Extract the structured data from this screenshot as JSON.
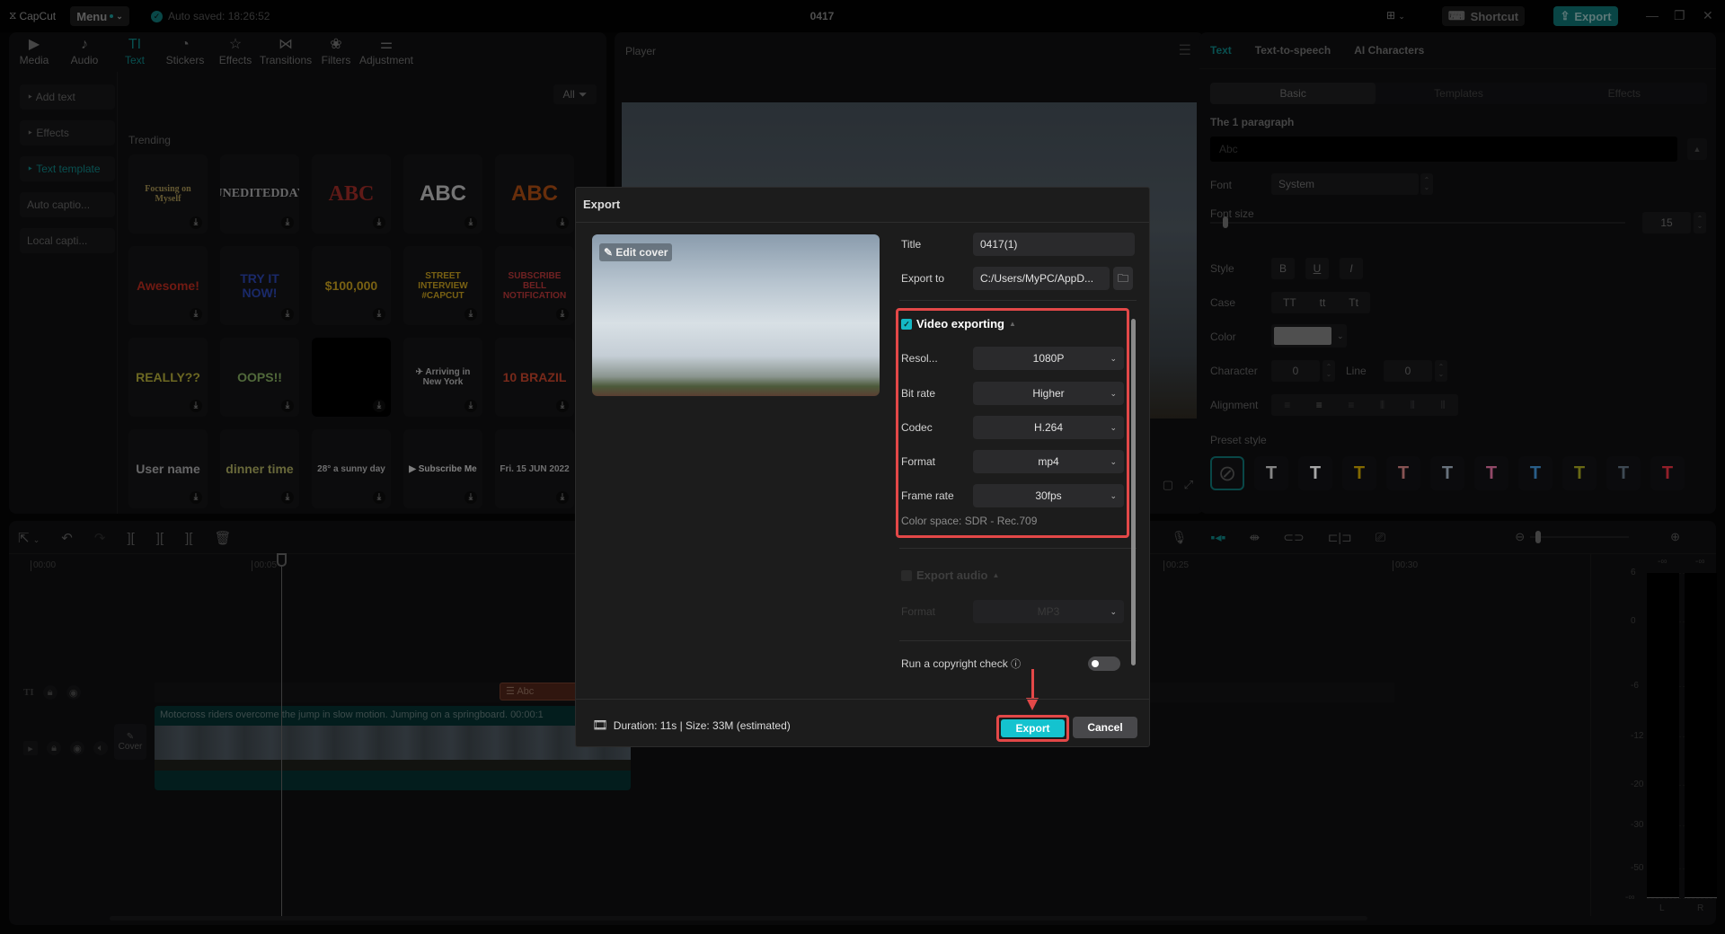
{
  "titlebar": {
    "app_name": "CapCut",
    "menu_label": "Menu",
    "auto_saved": "Auto saved: 18:26:52",
    "project_title": "0417",
    "shortcut_label": "Shortcut",
    "export_label": "Export",
    "minimize": "—",
    "maximize": "❐",
    "close": "✕"
  },
  "left_panel": {
    "tabs": [
      {
        "label": "Media",
        "icon": "▶"
      },
      {
        "label": "Audio",
        "icon": "♪"
      },
      {
        "label": "Text",
        "icon": "TI",
        "active": true
      },
      {
        "label": "Stickers",
        "icon": "◔"
      },
      {
        "label": "Effects",
        "icon": "☆"
      },
      {
        "label": "Transitions",
        "icon": "⋈"
      },
      {
        "label": "Filters",
        "icon": "❀"
      },
      {
        "label": "Adjustment",
        "icon": "⚌"
      }
    ],
    "nav": [
      {
        "label": "‣ Add text"
      },
      {
        "label": "‣ Effects"
      },
      {
        "label": "‣ Text template",
        "active": true
      },
      {
        "label": "Auto captio..."
      },
      {
        "label": "Local capti..."
      }
    ],
    "filter_label": "All",
    "section_title": "Trending",
    "templates": [
      {
        "text": "Focusing on Myself",
        "color": "#c8b060"
      },
      {
        "text": "UNEDITEDDAY",
        "color": "#cccccc"
      },
      {
        "text": "ABC",
        "color": "#c0302a"
      },
      {
        "text": "ABC",
        "color": "#e8e8e8"
      },
      {
        "text": "ABC",
        "color": "#d05a10"
      },
      {
        "text": "Awesome!",
        "color": "#e03020"
      },
      {
        "text": "TRY IT NOW!",
        "color": "#3050d0"
      },
      {
        "text": "$100,000",
        "color": "#f0c020"
      },
      {
        "text": "STREET INTERVIEW #CAPCUT",
        "color": "#f0c020"
      },
      {
        "text": "SUBSCRIBE BELL NOTIFICATION",
        "color": "#e04040"
      },
      {
        "text": "REALLY??",
        "color": "#d8d040"
      },
      {
        "text": "OOPS!!",
        "color": "#a0d070"
      },
      {
        "text": "",
        "color": "#000000"
      },
      {
        "text": "✈ Arriving in New York",
        "color": "#dddddd"
      },
      {
        "text": "10 BRAZIL",
        "color": "#f05030"
      },
      {
        "text": "User name",
        "color": "#cccccc"
      },
      {
        "text": "dinner time",
        "color": "#d0d070"
      },
      {
        "text": "28° a sunny day",
        "color": "#dddddd"
      },
      {
        "text": "▶ Subscribe Me",
        "color": "#ffffff"
      },
      {
        "text": "Fri. 15 JUN 2022",
        "color": "#dddddd"
      }
    ]
  },
  "player": {
    "title": "Player"
  },
  "right_panel": {
    "tabs": [
      {
        "label": "Text",
        "active": true
      },
      {
        "label": "Text-to-speech"
      },
      {
        "label": "AI Characters"
      }
    ],
    "subtabs": [
      {
        "label": "Basic",
        "active": true
      },
      {
        "label": "Templates"
      },
      {
        "label": "Effects"
      }
    ],
    "paragraph_label": "The 1 paragraph",
    "text_placeholder": "Abc",
    "font_label": "Font",
    "font_value": "System",
    "font_size_label": "Font size",
    "font_size_value": "15",
    "style_label": "Style",
    "style_buttons": [
      "B",
      "U",
      "I"
    ],
    "case_label": "Case",
    "case_buttons": [
      "TT",
      "tt",
      "Tt"
    ],
    "color_label": "Color",
    "color_value": "#7a7a7a",
    "character_label": "Character",
    "character_value": "0",
    "line_label": "Line",
    "line_value": "0",
    "alignment_label": "Alignment",
    "preset_label": "Preset style",
    "presets": [
      {
        "glyph": "⃠",
        "color": "#555555"
      },
      {
        "glyph": "T",
        "color": "#cccccc"
      },
      {
        "glyph": "T",
        "color": "#ffffff"
      },
      {
        "glyph": "T",
        "color": "#c8a000"
      },
      {
        "glyph": "T",
        "color": "#d08080"
      },
      {
        "glyph": "T",
        "color": "#a0b0c0"
      },
      {
        "glyph": "T",
        "color": "#e070a0"
      },
      {
        "glyph": "T",
        "color": "#4090d0"
      },
      {
        "glyph": "T",
        "color": "#a0a020"
      },
      {
        "glyph": "T",
        "color": "#607080"
      },
      {
        "glyph": "T",
        "color": "#e03040"
      }
    ]
  },
  "timeline": {
    "ruler": [
      "00:00",
      "00:05",
      "00:25",
      "00:30"
    ],
    "clip_label": "Motocross riders overcome the jump in slow motion. Jumping on a springboard.   00:00:1",
    "text_clip_label": "Abc",
    "cover_label": "Cover",
    "meter": {
      "top_labels": [
        "-∞",
        "-∞"
      ],
      "scale": [
        "6",
        "0",
        "-6",
        "-12",
        "-20",
        "-30",
        "-50",
        "-∞"
      ],
      "channels": [
        "L",
        "R"
      ]
    }
  },
  "export_dialog": {
    "title": "Export",
    "edit_cover_label": "Edit cover",
    "title_label": "Title",
    "title_value": "0417(1)",
    "export_to_label": "Export to",
    "export_to_value": "C:/Users/MyPC/AppD...",
    "video_section": {
      "label": "Video exporting",
      "checked": true,
      "fields": [
        {
          "label": "Resol...",
          "value": "1080P"
        },
        {
          "label": "Bit rate",
          "value": "Higher"
        },
        {
          "label": "Codec",
          "value": "H.264"
        },
        {
          "label": "Format",
          "value": "mp4"
        },
        {
          "label": "Frame rate",
          "value": "30fps"
        }
      ],
      "color_space": "Color space: SDR - Rec.709"
    },
    "audio_section": {
      "label": "Export audio",
      "checked": false,
      "format_label": "Format",
      "format_value": "MP3"
    },
    "copyright_label": "Run a copyright check",
    "copyright_enabled": false,
    "footer_info": "Duration: 11s | Size: 33M (estimated)",
    "export_button": "Export",
    "cancel_button": "Cancel",
    "accent_color": "#14c3cf",
    "highlight_color": "#e34848"
  }
}
